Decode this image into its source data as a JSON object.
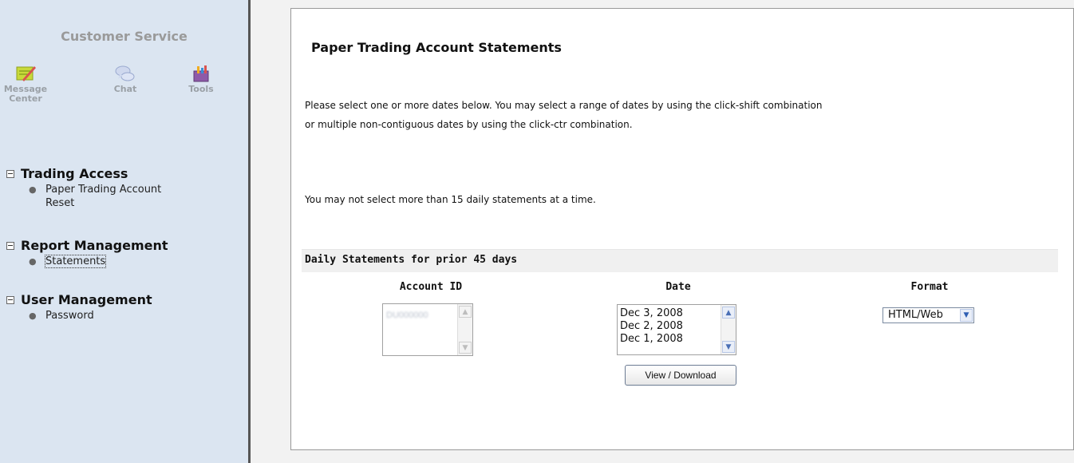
{
  "sidebar": {
    "title": "Customer Service",
    "tools": [
      {
        "label": "Message\nCenter",
        "label_line1": "Message",
        "label_line2": "Center",
        "icon": "message-center-icon"
      },
      {
        "label": "Chat",
        "icon": "chat-icon"
      },
      {
        "label": "Tools",
        "icon": "tools-icon"
      }
    ],
    "sections": [
      {
        "title": "Trading Access",
        "items": [
          {
            "line1": "Paper Trading Account",
            "line2": "Reset"
          }
        ]
      },
      {
        "title": "Report Management",
        "items": [
          {
            "label": "Statements"
          }
        ]
      },
      {
        "title": "User Management",
        "items": [
          {
            "label": "Password"
          }
        ]
      }
    ]
  },
  "main": {
    "title": "Paper Trading Account Statements",
    "instructions_line1": "Please select one or more dates below. You may select a range of dates by using the click-shift combination",
    "instructions_line2": "or multiple non-contiguous dates by using the click-ctr combination.",
    "limit_note": "You may not select more than 15 daily statements at a time.",
    "section_title": "Daily Statements for prior 45 days",
    "columns": {
      "account": "Account ID",
      "date": "Date",
      "format": "Format"
    },
    "account_value": "DU000000",
    "dates": [
      "Dec 3, 2008",
      "Dec 2, 2008",
      "Dec 1, 2008"
    ],
    "format_selected": "HTML/Web",
    "view_button": "View / Download"
  },
  "colors": {
    "sidebar_bg": "#dbe5f1",
    "page_bg": "#f2f2f2",
    "accent": "#4a6fb5"
  }
}
